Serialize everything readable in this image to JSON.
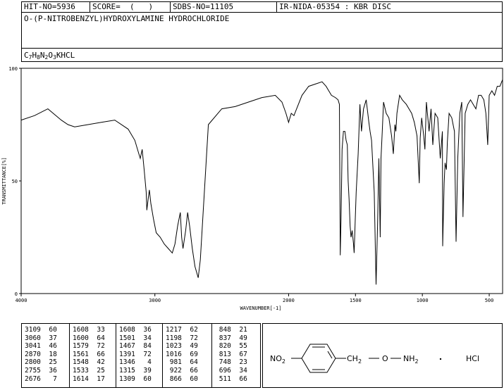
{
  "header": {
    "hit_no": "HIT-NO=5936",
    "score": "SCORE=  (   )",
    "sdbs_no": "SDBS-NO=11105",
    "ir_id": "IR-NIDA-05354 : KBR DISC"
  },
  "compound_name": "O-(P-NITROBENZYL)HYDROXYLAMINE HYDROCHLORIDE",
  "formula": {
    "parts": [
      {
        "text": "C",
        "sub": false
      },
      {
        "text": "7",
        "sub": true
      },
      {
        "text": "H",
        "sub": false
      },
      {
        "text": "8",
        "sub": true
      },
      {
        "text": "N",
        "sub": false
      },
      {
        "text": "2",
        "sub": true
      },
      {
        "text": "O",
        "sub": false
      },
      {
        "text": "3",
        "sub": true
      },
      {
        "text": "KHCL",
        "sub": false
      }
    ]
  },
  "chart_data": {
    "type": "line",
    "xlabel": "WAVENUMBER[-1]",
    "ylabel": "TRANSMITTANCE[%]",
    "xlim": [
      4000,
      400
    ],
    "ylim": [
      0,
      100
    ],
    "x_ticks": [
      4000,
      3000,
      2000,
      1500,
      1000,
      500
    ],
    "y_ticks": [
      0,
      50,
      100
    ],
    "series": [
      {
        "x": [
          4000,
          3900,
          3800,
          3700,
          3650,
          3600,
          3500,
          3400,
          3300,
          3200,
          3150,
          3120,
          3109,
          3095,
          3080,
          3065,
          3060,
          3050,
          3041,
          3030,
          3010,
          2990,
          2960,
          2930,
          2900,
          2870,
          2850,
          2830,
          2810,
          2800,
          2790,
          2770,
          2755,
          2740,
          2720,
          2700,
          2676,
          2660,
          2640,
          2600,
          2500,
          2400,
          2300,
          2200,
          2100,
          2050,
          2020,
          2000,
          1980,
          1960,
          1940,
          1900,
          1850,
          1800,
          1750,
          1720,
          1700,
          1680,
          1650,
          1630,
          1620,
          1614,
          1608,
          1600,
          1590,
          1579,
          1570,
          1561,
          1555,
          1548,
          1540,
          1533,
          1525,
          1515,
          1510,
          1501,
          1495,
          1480,
          1467,
          1455,
          1440,
          1420,
          1400,
          1391,
          1380,
          1360,
          1346,
          1335,
          1325,
          1315,
          1309,
          1300,
          1290,
          1270,
          1250,
          1230,
          1217,
          1205,
          1198,
          1190,
          1170,
          1150,
          1120,
          1100,
          1080,
          1060,
          1040,
          1023,
          1016,
          1005,
          990,
          981,
          970,
          950,
          935,
          922,
          905,
          885,
          866,
          850,
          848,
          837,
          830,
          820,
          813,
          800,
          780,
          760,
          748,
          735,
          720,
          705,
          696,
          680,
          660,
          640,
          620,
          600,
          580,
          560,
          540,
          525,
          511,
          500,
          480,
          460,
          440,
          420,
          400
        ],
        "y": [
          77,
          79,
          82,
          77,
          75,
          74,
          75,
          76,
          77,
          73,
          68,
          62,
          60,
          64,
          55,
          45,
          37,
          42,
          46,
          40,
          33,
          27,
          25,
          22,
          20,
          18,
          22,
          30,
          36,
          25,
          20,
          28,
          36,
          30,
          20,
          12,
          7,
          15,
          35,
          75,
          82,
          83,
          85,
          87,
          88,
          85,
          80,
          76,
          80,
          79,
          82,
          88,
          92,
          93,
          94,
          92,
          90,
          88,
          87,
          86,
          84,
          17,
          33,
          64,
          72,
          72,
          68,
          66,
          50,
          42,
          30,
          25,
          28,
          22,
          18,
          34,
          45,
          62,
          84,
          72,
          82,
          86,
          76,
          72,
          68,
          45,
          4,
          30,
          60,
          25,
          60,
          72,
          85,
          80,
          78,
          70,
          62,
          75,
          72,
          80,
          88,
          86,
          84,
          82,
          80,
          76,
          70,
          49,
          69,
          78,
          70,
          64,
          85,
          72,
          82,
          66,
          80,
          78,
          60,
          72,
          21,
          49,
          58,
          55,
          67,
          80,
          78,
          72,
          23,
          60,
          80,
          85,
          34,
          80,
          84,
          86,
          84,
          82,
          88,
          88,
          86,
          80,
          66,
          88,
          90,
          88,
          92,
          92,
          95
        ]
      }
    ]
  },
  "peak_table": [
    [
      [
        3109,
        60
      ],
      [
        3060,
        37
      ],
      [
        3041,
        46
      ],
      [
        2870,
        18
      ],
      [
        2800,
        25
      ],
      [
        2755,
        36
      ],
      [
        2676,
        7
      ]
    ],
    [
      [
        1608,
        33
      ],
      [
        1600,
        64
      ],
      [
        1579,
        72
      ],
      [
        1561,
        66
      ],
      [
        1548,
        42
      ],
      [
        1533,
        25
      ],
      [
        1614,
        17
      ]
    ],
    [
      [
        1608,
        36
      ],
      [
        1501,
        34
      ],
      [
        1467,
        84
      ],
      [
        1391,
        72
      ],
      [
        1346,
        4
      ],
      [
        1315,
        39
      ],
      [
        1309,
        60
      ]
    ],
    [
      [
        1217,
        62
      ],
      [
        1198,
        72
      ],
      [
        1023,
        49
      ],
      [
        1016,
        69
      ],
      [
        981,
        64
      ],
      [
        922,
        66
      ],
      [
        866,
        60
      ]
    ],
    [
      [
        848,
        21
      ],
      [
        837,
        49
      ],
      [
        820,
        55
      ],
      [
        813,
        67
      ],
      [
        748,
        23
      ],
      [
        696,
        34
      ],
      [
        511,
        66
      ]
    ]
  ],
  "structure": {
    "left_group": "NO2",
    "ch2": "CH2",
    "o": "O",
    "nh2": "NH2",
    "salt": "HCl"
  }
}
